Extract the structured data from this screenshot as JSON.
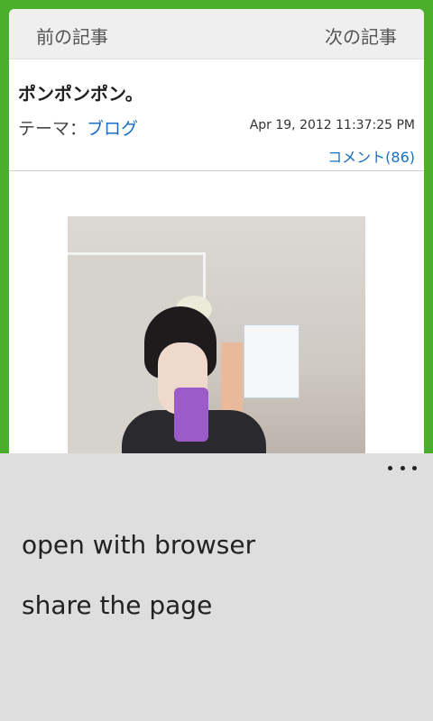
{
  "nav": {
    "prev_label": "前の記事",
    "next_label": "次の記事"
  },
  "article": {
    "title": "ポンポンポン。",
    "theme_prefix": "テーマ：",
    "theme_link": "ブログ",
    "date": "Apr 19, 2012 11:37:25 PM",
    "comments": "コメント(86)"
  },
  "sheet": {
    "more_icon": "ellipsis-icon",
    "items": [
      {
        "label": "open with browser"
      },
      {
        "label": "share the page"
      }
    ]
  },
  "colors": {
    "frame_bg": "#4aae2a",
    "link": "#1a6fc4",
    "sheet_bg": "#dedede"
  }
}
